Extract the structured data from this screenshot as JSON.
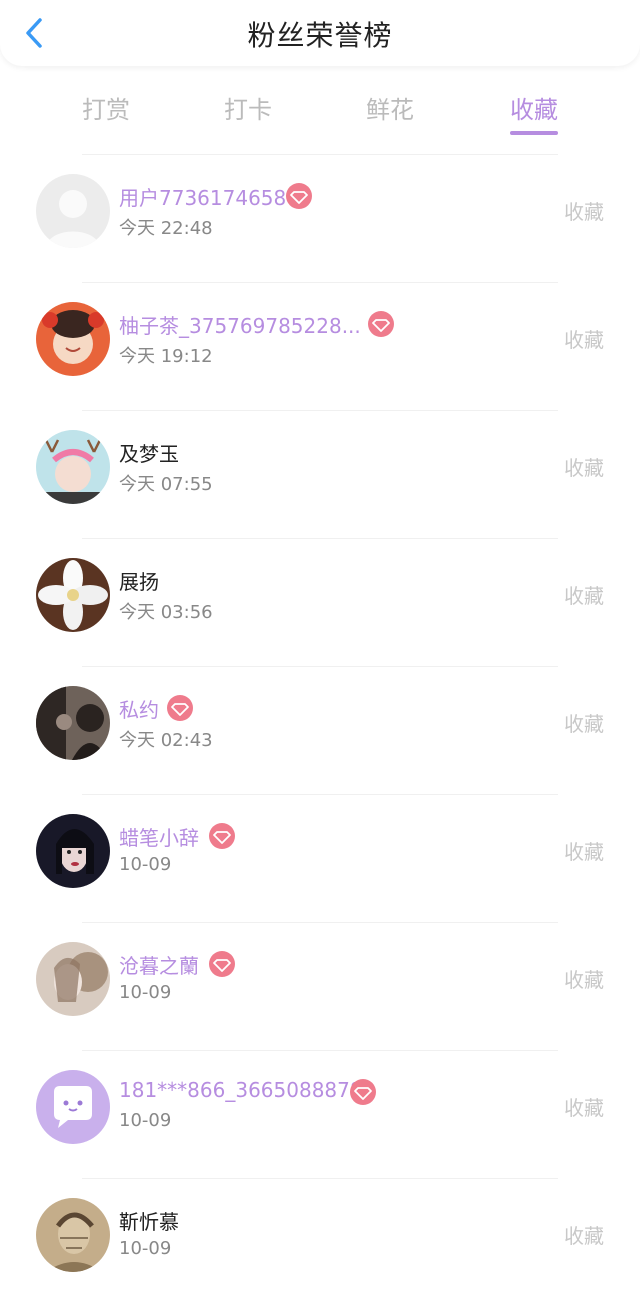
{
  "header": {
    "title": "粉丝荣誉榜",
    "back_icon": "chevron-left-icon"
  },
  "tabs": [
    {
      "label": "打赏",
      "active": false
    },
    {
      "label": "打卡",
      "active": false
    },
    {
      "label": "鲜花",
      "active": false
    },
    {
      "label": "收藏",
      "active": true
    }
  ],
  "colors": {
    "accent": "#b68de0",
    "back": "#3a9af5",
    "gem": "#ef7b8c",
    "muted": "#c8c8c8"
  },
  "fans": [
    {
      "name": "用户7736174658",
      "time": "今天 22:48",
      "vip": true,
      "action": "收藏",
      "avatar_icon": "default-user-avatar"
    },
    {
      "name": "柚子茶_375769785228...",
      "time": "今天 19:12",
      "vip": true,
      "action": "收藏",
      "avatar_icon": "photo-avatar"
    },
    {
      "name": "及梦玉",
      "time": "今天 07:55",
      "vip": false,
      "action": "收藏",
      "avatar_icon": "photo-avatar"
    },
    {
      "name": "展扬",
      "time": "今天 03:56",
      "vip": false,
      "action": "收藏",
      "avatar_icon": "flower-avatar"
    },
    {
      "name": "私约",
      "time": "今天 02:43",
      "vip": true,
      "action": "收藏",
      "avatar_icon": "photo-avatar"
    },
    {
      "name": "蜡笔小辞",
      "time": "10-09",
      "vip": true,
      "action": "收藏",
      "avatar_icon": "photo-avatar"
    },
    {
      "name": "沧暮之蘭",
      "time": "10-09",
      "vip": true,
      "action": "收藏",
      "avatar_icon": "photo-avatar"
    },
    {
      "name": "181***866_3665088878",
      "time": "10-09",
      "vip": true,
      "action": "收藏",
      "avatar_icon": "chat-bubble-avatar"
    },
    {
      "name": "靳忻慕",
      "time": "10-09",
      "vip": false,
      "action": "收藏",
      "avatar_icon": "photo-avatar"
    }
  ]
}
